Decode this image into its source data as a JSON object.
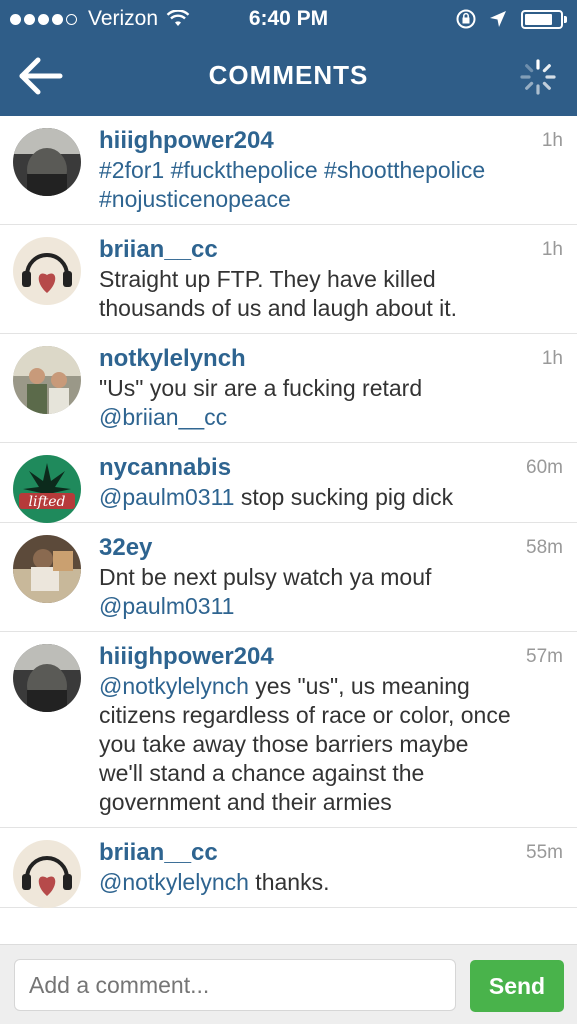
{
  "status_bar": {
    "carrier": "Verizon",
    "time": "6:40 PM",
    "signal_bars": 4,
    "signal_total": 5,
    "battery_level": 0.8,
    "icons": [
      "wifi-icon",
      "rotation-lock-icon",
      "location-arrow-icon",
      "battery-icon"
    ]
  },
  "nav": {
    "title": "COMMENTS",
    "back_icon": "back-arrow-icon",
    "spinner_icon": "loading-spinner-icon"
  },
  "comments": [
    {
      "username": "hiiighpower204",
      "time": "1h",
      "text": "#2for1 #fuckthepolice #shootthepolice #nojusticenopeace",
      "mention": "",
      "avatar_color": "#4a4a4a"
    },
    {
      "username": "briian__cc",
      "time": "1h",
      "text": "Straight up FTP. They have killed thousands of us and laugh about it.",
      "mention": "",
      "avatar_color": "#e8ddd0"
    },
    {
      "username": "notkylelynch",
      "time": "1h",
      "text": "\"Us\" you sir are a fucking retard",
      "mention": "@briian__cc",
      "avatar_color": "#8a8a7a"
    },
    {
      "username": "nycannabis",
      "time": "60m",
      "mention": "@paulm0311",
      "text": " stop sucking pig dick",
      "avatar_color": "#1f8a5c",
      "avatar_text": "lifted"
    },
    {
      "username": "32ey",
      "time": "58m",
      "text": "Dnt be next pulsy watch ya mouf",
      "mention": "@paulm0311",
      "avatar_color": "#6b5a4a"
    },
    {
      "username": "hiiighpower204",
      "time": "57m",
      "mention": "@notkylelynch",
      "text": " yes \"us\", us meaning citizens regardless of race or color, once you take away those barriers maybe we'll stand a chance against the government and their armies",
      "avatar_color": "#4a4a4a"
    },
    {
      "username": "briian__cc",
      "time": "55m",
      "mention": "@notkylelynch",
      "text": " thanks.",
      "avatar_color": "#e8ddd0"
    }
  ],
  "footer": {
    "placeholder": "Add a comment...",
    "send_label": "Send"
  },
  "colors": {
    "header": "#2f5d88",
    "username": "#2e6490",
    "send": "#49b34b"
  }
}
